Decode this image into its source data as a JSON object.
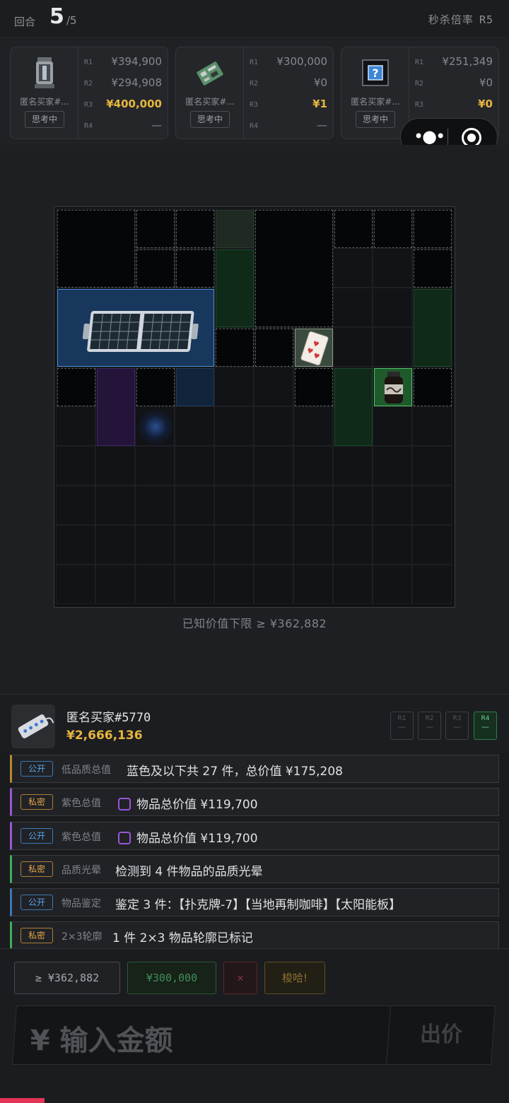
{
  "header": {
    "round_label": "回合",
    "round_current": "5",
    "round_total": "/5",
    "rate_label": "秒杀倍率",
    "rate_value": "R5"
  },
  "buyer_cards": [
    {
      "name": "匿名买家#...",
      "status": "思考中",
      "bids": [
        {
          "r": "R1",
          "v": "¥394,900"
        },
        {
          "r": "R2",
          "v": "¥294,908"
        },
        {
          "r": "R3",
          "v": "¥400,000"
        },
        {
          "r": "R4",
          "v": "—"
        }
      ]
    },
    {
      "name": "匿名买家#...",
      "status": "思考中",
      "bids": [
        {
          "r": "R1",
          "v": "¥300,000"
        },
        {
          "r": "R2",
          "v": "¥0"
        },
        {
          "r": "R3",
          "v": "¥1"
        },
        {
          "r": "R4",
          "v": "—"
        }
      ]
    },
    {
      "name": "匿名买家#...",
      "status": "思考中",
      "bids": [
        {
          "r": "R1",
          "v": "¥251,349"
        },
        {
          "r": "R2",
          "v": "¥0"
        },
        {
          "r": "R3",
          "v": "¥0"
        },
        {
          "r": "R4",
          "v": "—"
        }
      ]
    }
  ],
  "grid": {
    "known_value_text": "已知价值下限 ≥ ¥362,882",
    "playing_card_label": "♥"
  },
  "current_buyer": {
    "name": "匿名买家#5770",
    "value": "¥2,666,136",
    "rounds": [
      {
        "r": "R1",
        "v": "—"
      },
      {
        "r": "R2",
        "v": "—"
      },
      {
        "r": "R3",
        "v": "—"
      },
      {
        "r": "R4",
        "v": "—"
      }
    ]
  },
  "clues": [
    {
      "tag": "公开",
      "type": "低品质总值",
      "text": "蓝色及以下共 27 件，总价值 ¥175,208",
      "color": "#b8892f"
    },
    {
      "tag": "私密",
      "type": "紫色总值",
      "text": "物品总价值 ¥119,700",
      "color": "#9a55d6"
    },
    {
      "tag": "公开",
      "type": "紫色总值",
      "text": "物品总价值 ¥119,700",
      "color": "#9a55d6"
    },
    {
      "tag": "私密",
      "type": "品质光晕",
      "text": "检测到 4 件物品的品质光晕",
      "color": "#3fae5a"
    },
    {
      "tag": "公开",
      "type": "物品鉴定",
      "text": "鉴定 3 件：【扑克牌-7】【当地再制咖啡】【太阳能板】",
      "color": "#3f79b3"
    },
    {
      "tag": "私密",
      "type": "2×3轮廓",
      "text": "1 件 2×3 物品轮廓已标记",
      "color": "#3fae5a"
    }
  ],
  "controls": {
    "quick_bids": [
      "≥ ¥362,882",
      "¥300,000",
      "×",
      "梭哈!"
    ],
    "amount_placeholder": "¥ 输入金额",
    "bid_label": "出价"
  }
}
